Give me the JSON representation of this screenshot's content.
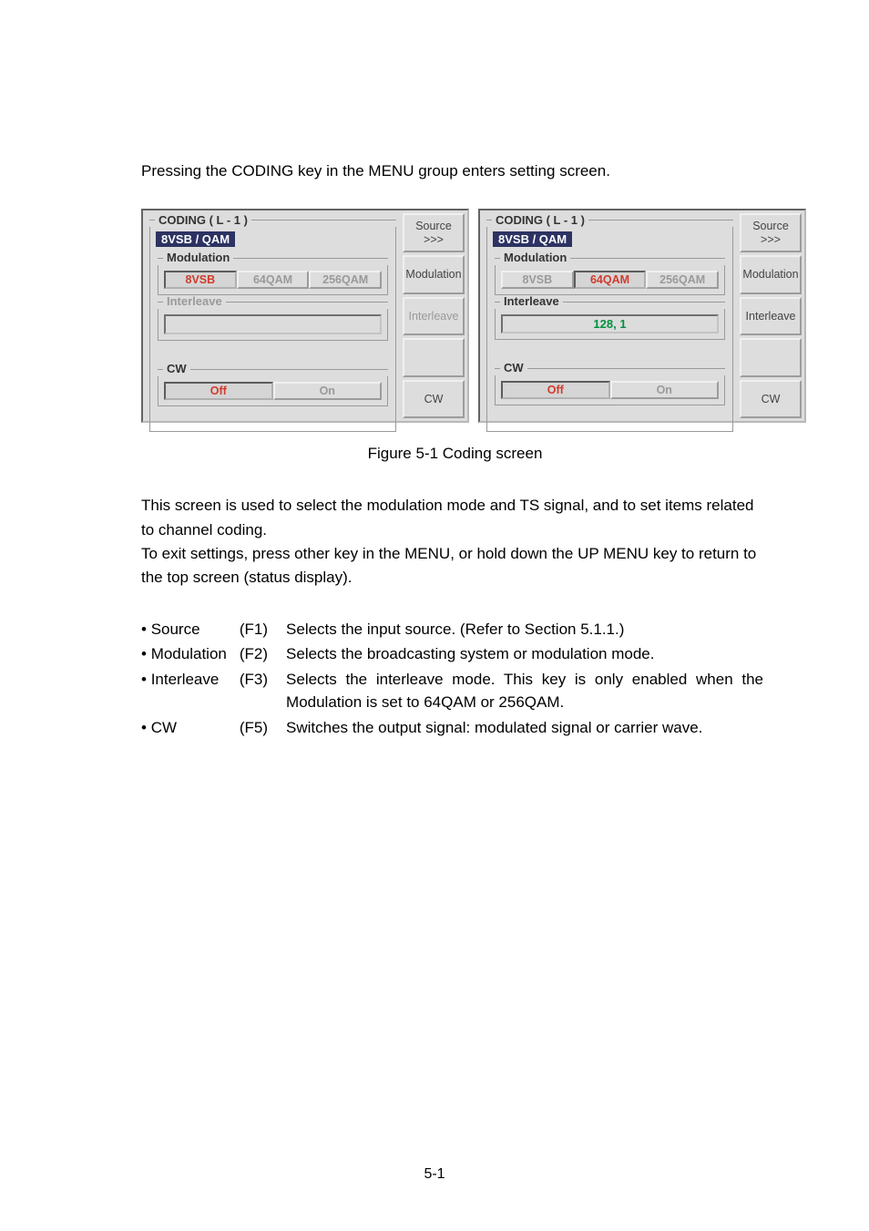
{
  "intro_text": "Pressing the CODING key in the MENU group enters setting screen.",
  "figure_caption": "Figure 5-1   Coding screen",
  "body_text1": "This screen is used to select the modulation mode and TS signal, and to set items related to channel coding.",
  "body_text2": "To exit settings, press other key in the MENU, or hold down the UP MENU key to return to the top screen (status display).",
  "page_no": "5-1",
  "panel": {
    "coding_title": "CODING ( L - 1 )",
    "mode_tag": "8VSB / QAM",
    "modulation_label": "Modulation",
    "mod_options": [
      "8VSB",
      "64QAM",
      "256QAM"
    ],
    "interleave_label": "Interleave",
    "interleave_value": "128, 1",
    "cw_label": "CW",
    "cw_options": [
      "Off",
      "On"
    ],
    "side": {
      "source": "Source",
      "chevrons": ">>>",
      "modulation": "Modulation",
      "interleave": "Interleave",
      "cw": "CW"
    }
  },
  "defs": [
    {
      "name": "Source",
      "fkey": "(F1)",
      "desc": "Selects the input source.   (Refer to Section 5.1.1.)"
    },
    {
      "name": "Modulation",
      "fkey": "(F2)",
      "desc": "Selects the broadcasting system or modulation mode."
    },
    {
      "name": "Interleave",
      "fkey": "(F3)",
      "desc": "Selects the interleave mode.  This key is only enabled when the Modulation is set to 64QAM or 256QAM."
    },
    {
      "name": "CW",
      "fkey": "(F5)",
      "desc": "Switches the output signal: modulated signal or carrier wave."
    }
  ]
}
